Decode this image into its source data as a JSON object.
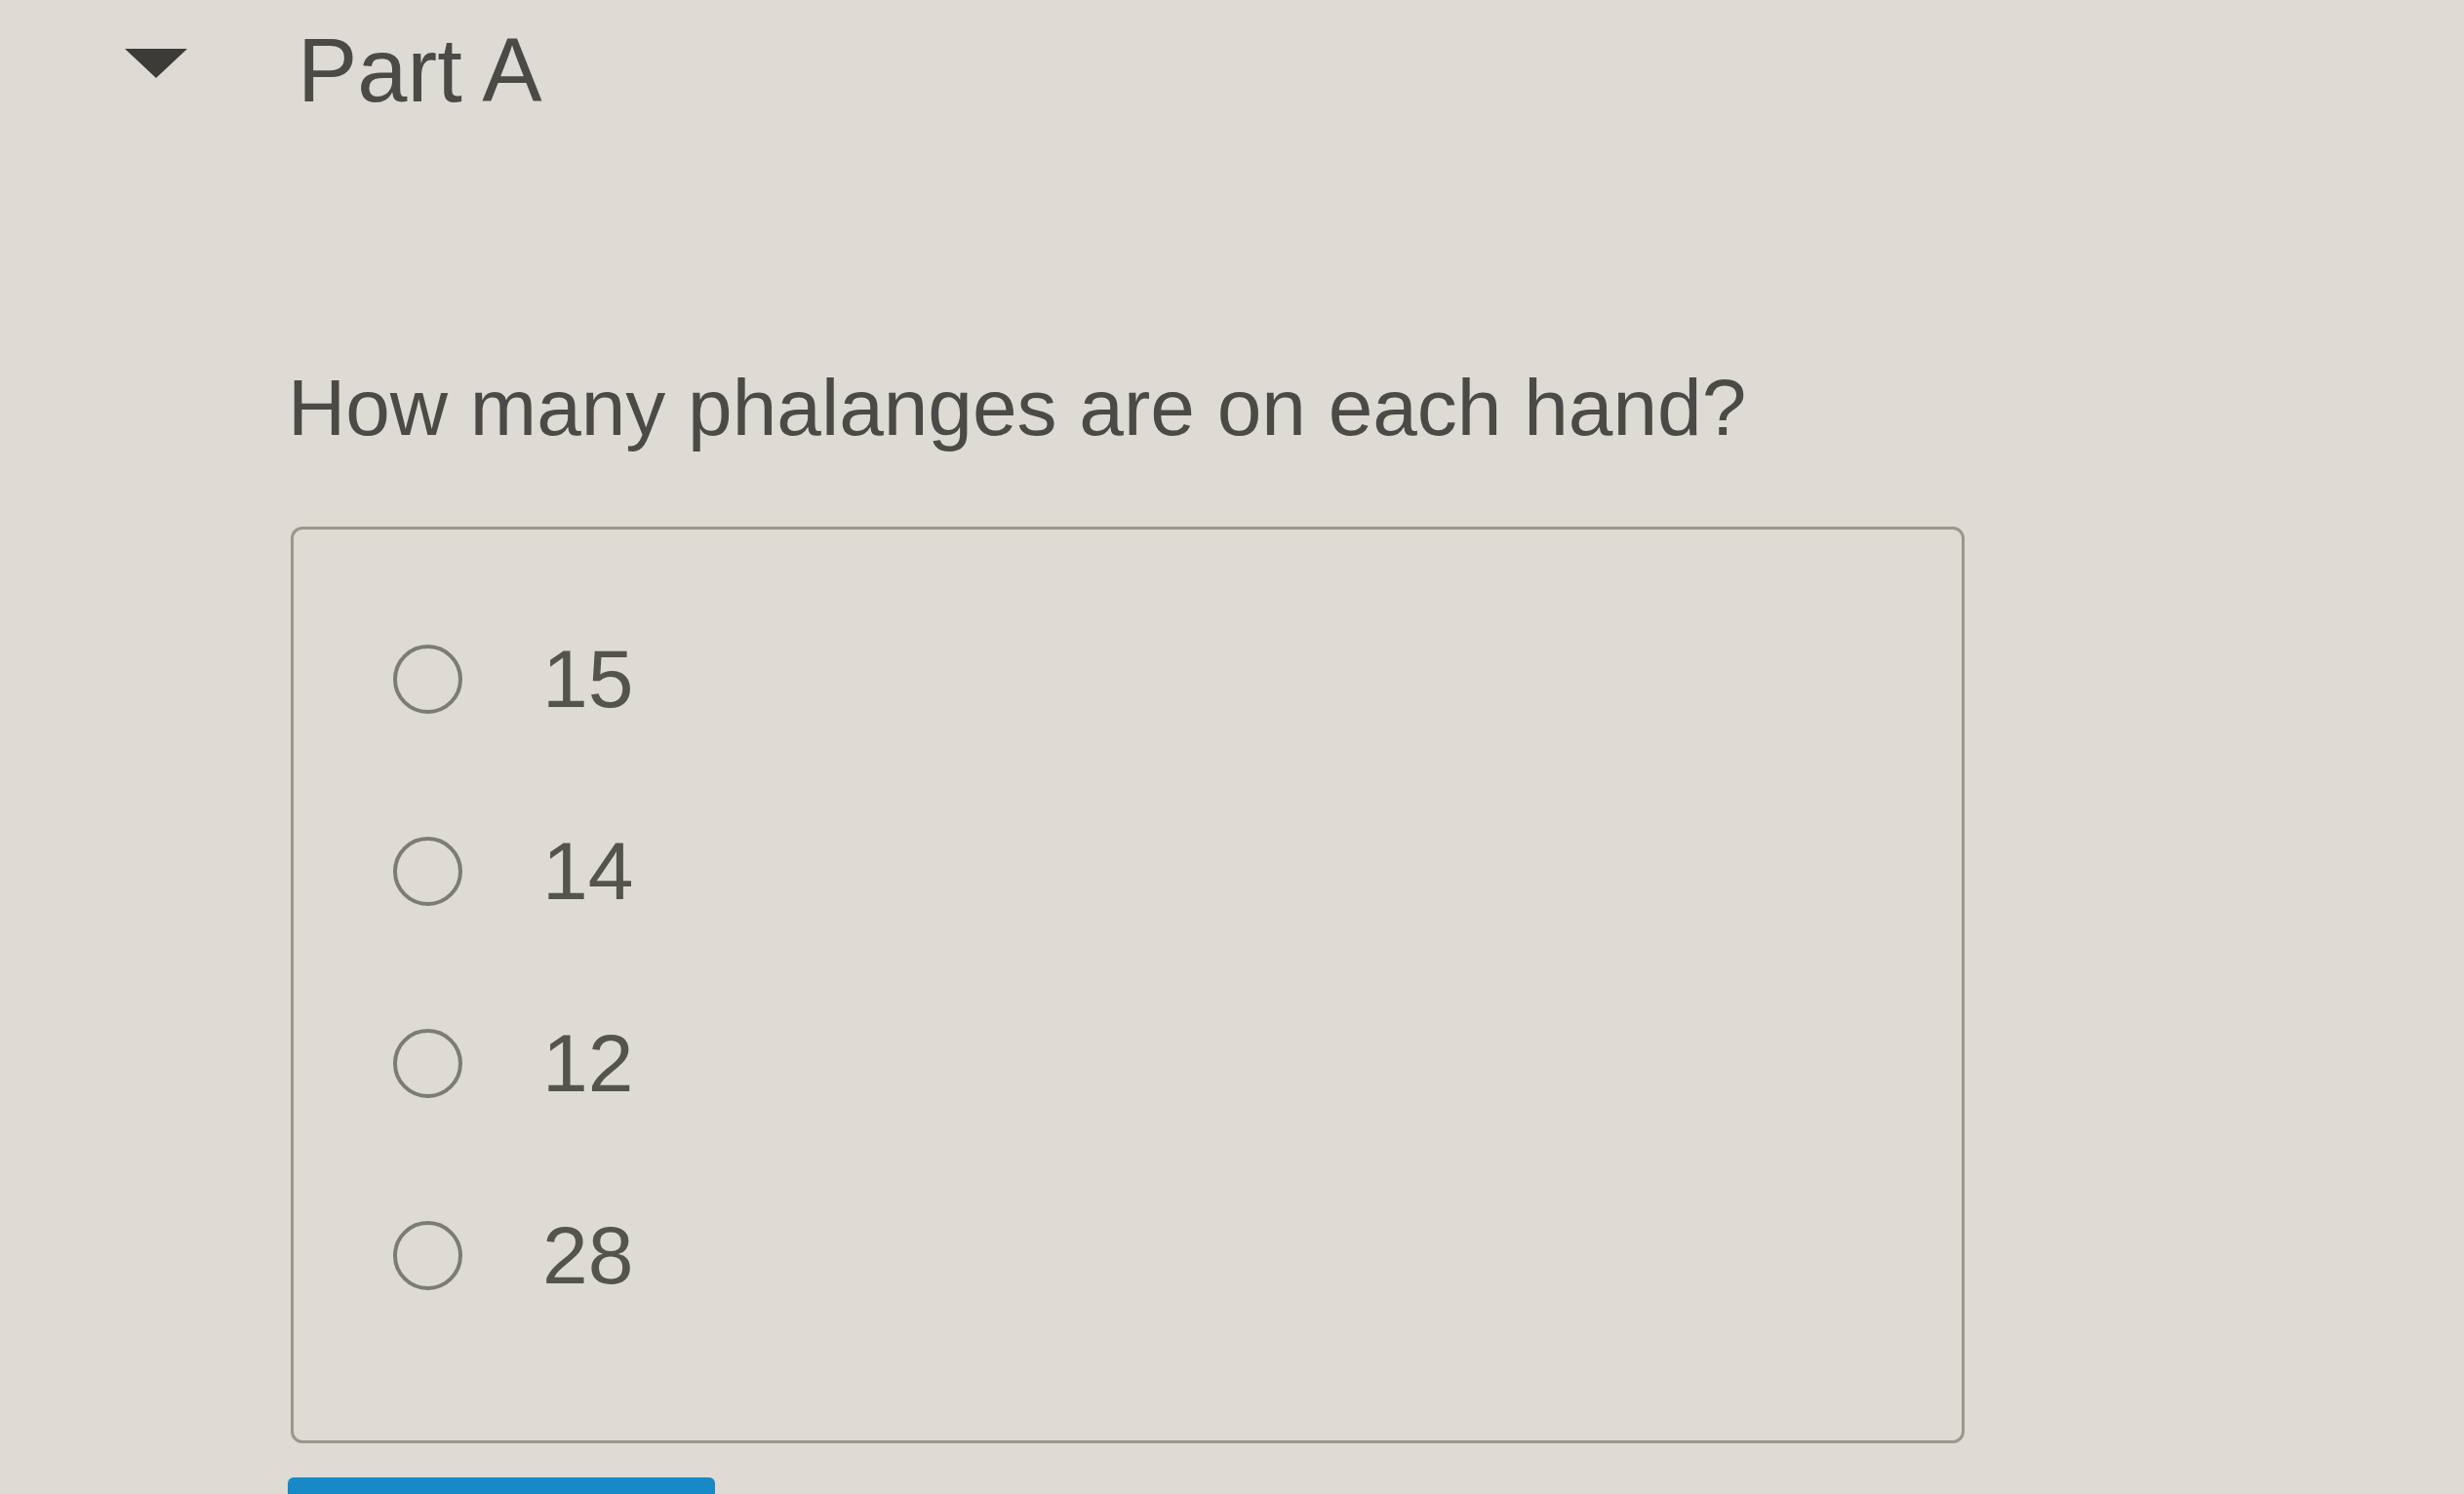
{
  "part": {
    "title": "Part A",
    "expanded": true
  },
  "question": {
    "text": "How many phalanges are on each hand?"
  },
  "options": [
    {
      "label": "15",
      "selected": false
    },
    {
      "label": "14",
      "selected": false
    },
    {
      "label": "12",
      "selected": false
    },
    {
      "label": "28",
      "selected": false
    }
  ]
}
